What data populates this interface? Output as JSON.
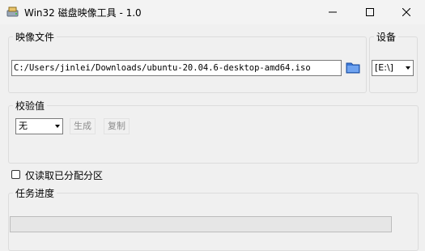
{
  "window": {
    "title": "Win32 磁盘映像工具 - 1.0"
  },
  "image_file": {
    "legend": "映像文件",
    "path": "C:/Users/jinlei/Downloads/ubuntu-20.04.6-desktop-amd64.iso"
  },
  "device": {
    "legend": "设备",
    "selected": "[E:\\]"
  },
  "hash": {
    "legend": "校验值",
    "type_selected": "无",
    "generate_label": "生成",
    "copy_label": "复制"
  },
  "read_only": {
    "label": "仅读取已分配分区",
    "checked": false
  },
  "progress": {
    "legend": "任务进度",
    "value": 0
  },
  "colors": {
    "folder_icon": "#3b78d8"
  }
}
